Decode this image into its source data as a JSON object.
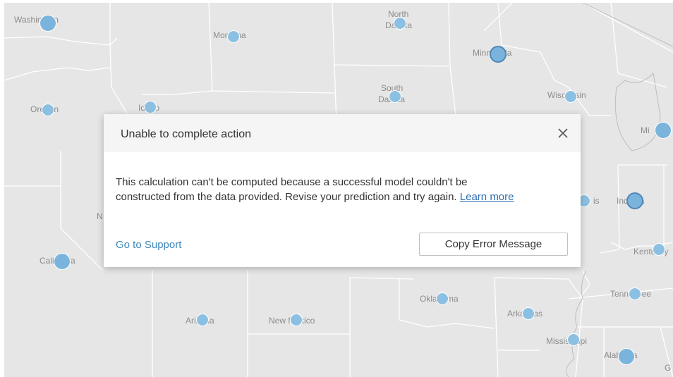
{
  "map": {
    "labels": {
      "washington": "Washington",
      "montana": "Montana",
      "north_dakota_1": "North",
      "north_dakota_2": "Dakota",
      "minnesota": "Minnesota",
      "oregon": "Oregon",
      "idaho": "Idaho",
      "south_dakota_1": "South",
      "south_dakota_2": "Dakota",
      "wisconsin": "Wisconsin",
      "michigan": "Mi",
      "illinois": "is",
      "indiana": "Indiana",
      "nevada": "N",
      "california": "California",
      "kentucky": "Kentucky",
      "oklahoma": "Oklahoma",
      "arkansas": "Arkansas",
      "tennessee": "Tennessee",
      "arizona": "Arizona",
      "new_mexico": "New Mexico",
      "mississippi": "Mississippi",
      "alabama": "Alabama",
      "georgia": "G"
    },
    "marker_color": "#8cc0e2",
    "background": "#e6e6e6"
  },
  "dialog": {
    "title": "Unable to complete action",
    "close_icon": "close-icon",
    "message_line1": "This calculation can't be computed because a successful model couldn't be",
    "message_line2": "constructed from the data provided. Revise your prediction and try again.",
    "learn_more": "Learn more",
    "support_link": "Go to Support",
    "copy_button": "Copy Error Message",
    "link_color": "#3c87b5"
  }
}
